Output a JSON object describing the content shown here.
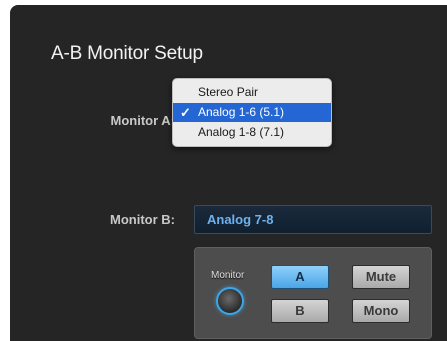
{
  "title": "A-B Monitor Setup",
  "monitor_a": {
    "label": "Monitor A:",
    "options": [
      "Stereo Pair",
      "Analog 1-6 (5.1)",
      "Analog 1-8 (7.1)"
    ],
    "selected": "Analog 1-6 (5.1)",
    "check": "✓"
  },
  "monitor_b": {
    "label": "Monitor B:",
    "value": "Analog 7-8"
  },
  "controls": {
    "knob_label": "Monitor",
    "a_label": "A",
    "b_label": "B",
    "mute_label": "Mute",
    "mono_label": "Mono",
    "accent": "#4aa5e6"
  }
}
